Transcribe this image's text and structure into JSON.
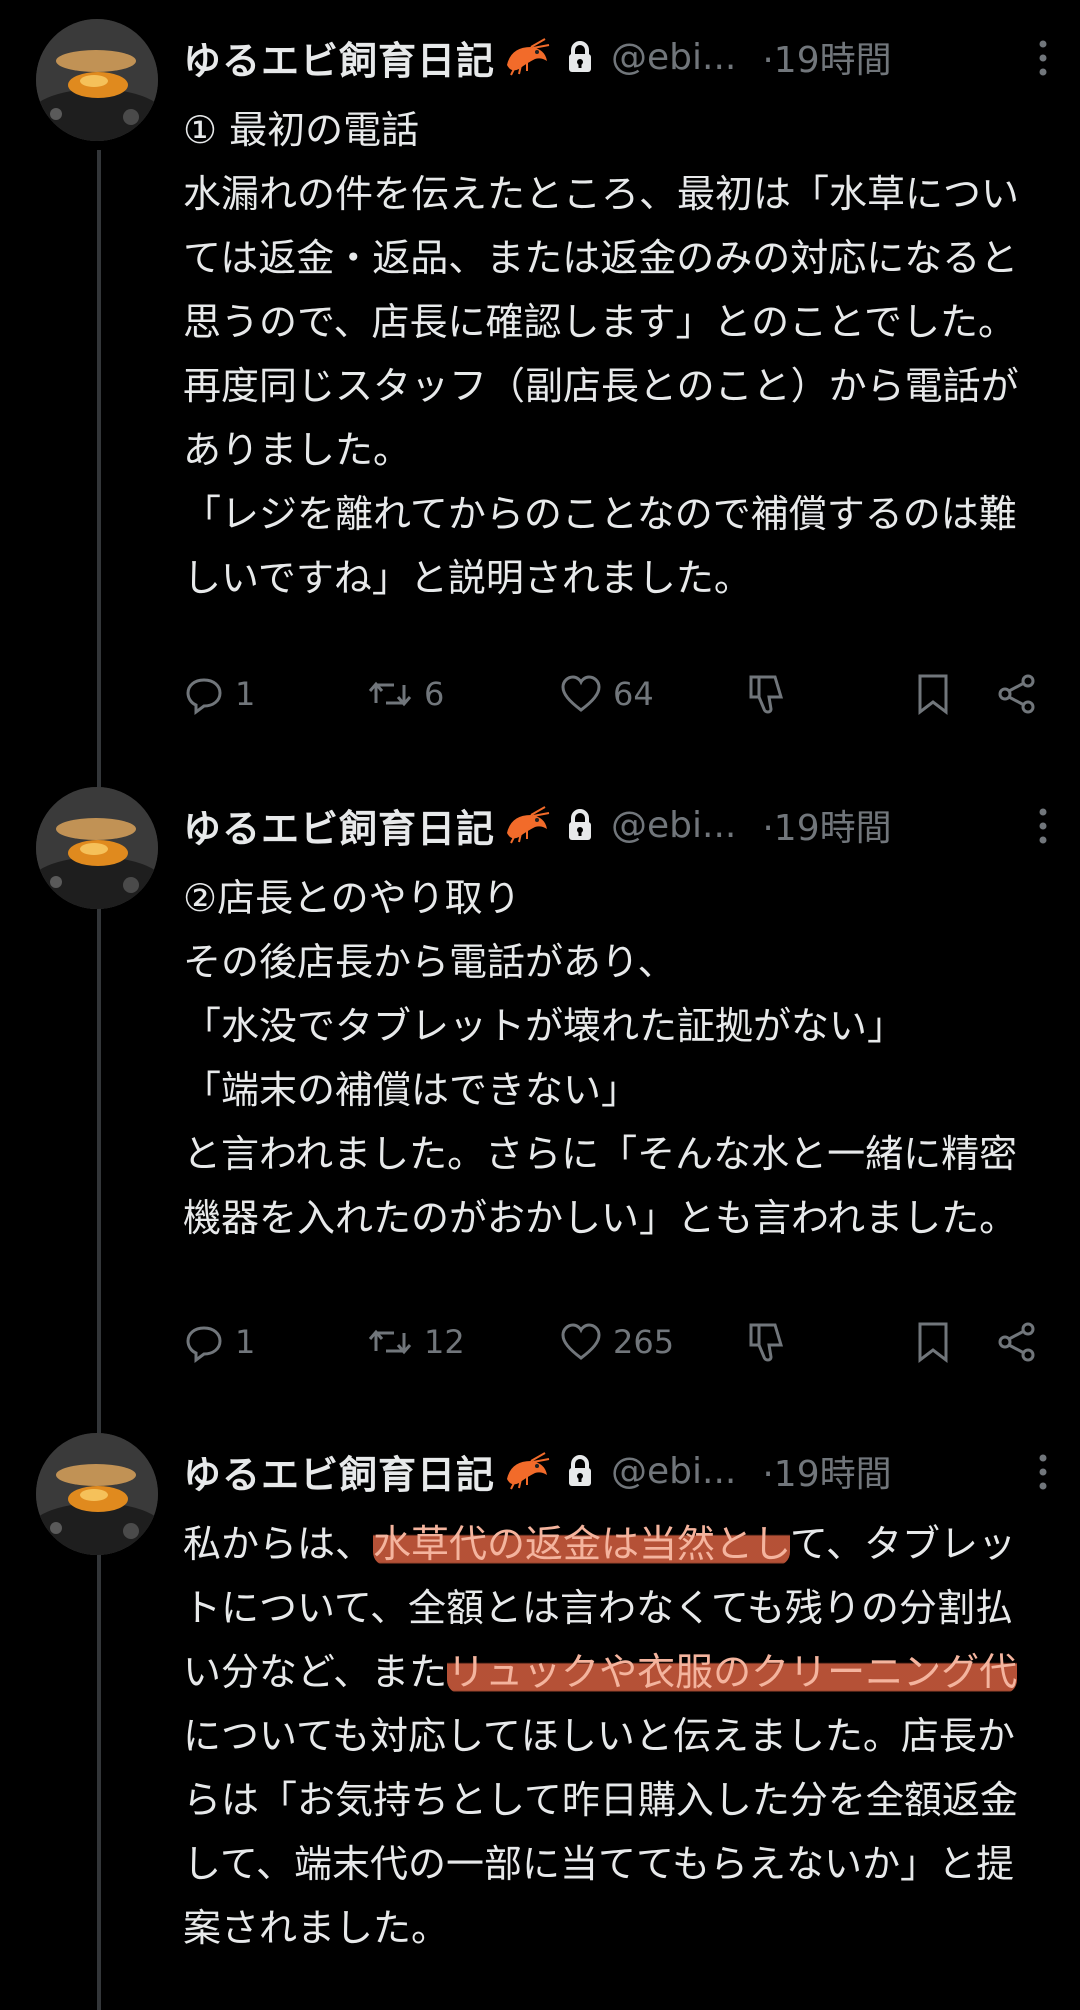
{
  "colors": {
    "background": "#000000",
    "text": "#e7e9ea",
    "secondary": "#71767b",
    "thread_line": "#333639",
    "highlight": "#e86846"
  },
  "tweets": [
    {
      "author_name": "ゆるエビ飼育日記",
      "emoji": "shrimp-icon",
      "handle": "@ebi...",
      "time": "·19時間",
      "text": "① 最初の電話\n水漏れの件を伝えたところ、最初は「水草については返金・返品、または返金のみの対応になると思うので、店長に確認します」とのことでした。再度同じスタッフ（副店長とのこと）から電話がありました。\n「レジを離れてからのことなので補償するのは難しいですね」と説明されました。",
      "reply_count": "1",
      "repost_count": "6",
      "like_count": "64"
    },
    {
      "author_name": "ゆるエビ飼育日記",
      "emoji": "shrimp-icon",
      "handle": "@ebi...",
      "time": "·19時間",
      "text": "②店長とのやり取り\nその後店長から電話があり、\n「水没でタブレットが壊れた証拠がない」\n「端末の補償はできない」\nと言われました。さらに「そんな水と一緒に精密機器を入れたのがおかしい」とも言われました。",
      "reply_count": "1",
      "repost_count": "12",
      "like_count": "265"
    },
    {
      "author_name": "ゆるエビ飼育日記",
      "emoji": "shrimp-icon",
      "handle": "@ebi...",
      "time": "·19時間",
      "text_parts": [
        "私からは、",
        "水草代の返金は当然とし",
        "て、タブレットについて、全額とは言わなくても残りの分割払い分など、また",
        "リュックや衣服のクリーニング代",
        "についても対応してほしいと伝えました。店長からは「お気持ちとして昨日購入した分を全額返金して、端末代の一部に当ててもらえないか」と提案されました。"
      ]
    }
  ]
}
